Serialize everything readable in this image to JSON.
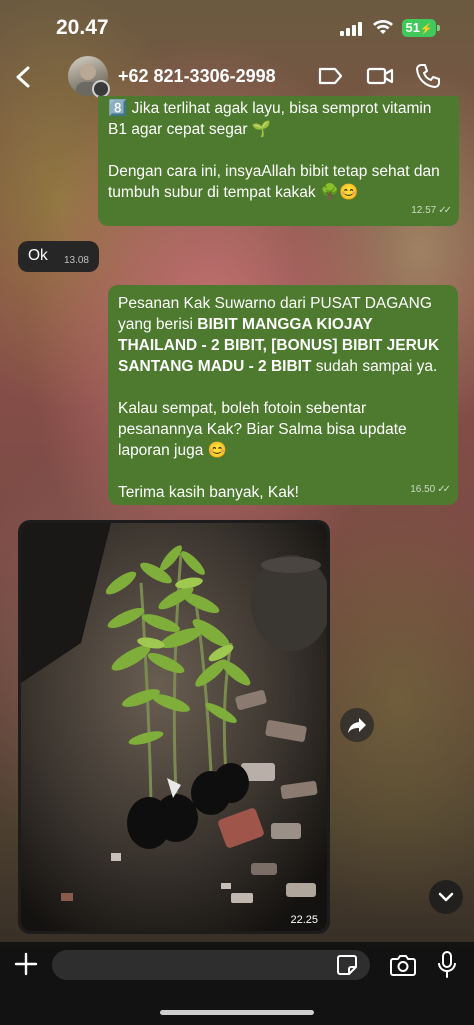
{
  "status_bar": {
    "time": "20.47",
    "battery": "51"
  },
  "header": {
    "contact_name": "+62 821-3306-2998"
  },
  "messages": [
    {
      "direction": "outgoing",
      "line1_emoji": "8️⃣",
      "line1": "Jika terlihat agak layu, bisa semprot vitamin B1 agar cepat segar 🌱",
      "line2": "Dengan cara ini, insyaAllah bibit tetap sehat dan tumbuh subur di tempat kakak 🌳😊",
      "time": "12.57",
      "status": "read"
    },
    {
      "direction": "incoming",
      "text": "Ok",
      "time": "13.08"
    },
    {
      "direction": "outgoing",
      "p1_a": "Pesanan Kak Suwarno dari PUSAT DAGANG yang berisi ",
      "p1_bold": "BIBIT MANGGA KIOJAY THAILAND - 2 BIBIT, [BONUS] BIBIT JERUK SANTANG MADU - 2 BIBIT",
      "p1_b": " sudah sampai ya.",
      "p2": "Kalau sempat, boleh fotoin sebentar pesanannya Kak? Biar Salma bisa update laporan juga 😊",
      "p3": "Terima kasih banyak, Kak!",
      "time": "16.50",
      "status": "read"
    },
    {
      "direction": "incoming",
      "type": "image",
      "image_description": "plant-seedlings-photo",
      "time": "22.25"
    }
  ],
  "composer": {
    "placeholder": ""
  },
  "icons": [
    "back-chevron-icon",
    "video-call-icon",
    "phone-icon",
    "camera-icon",
    "sticker-icon",
    "mic-icon",
    "plus-icon",
    "forward-icon",
    "chevron-down-icon"
  ],
  "colors": {
    "outgoing_bubble": "#4d7a2e",
    "incoming_bubble": "#262626",
    "battery": "#3ec95a"
  }
}
